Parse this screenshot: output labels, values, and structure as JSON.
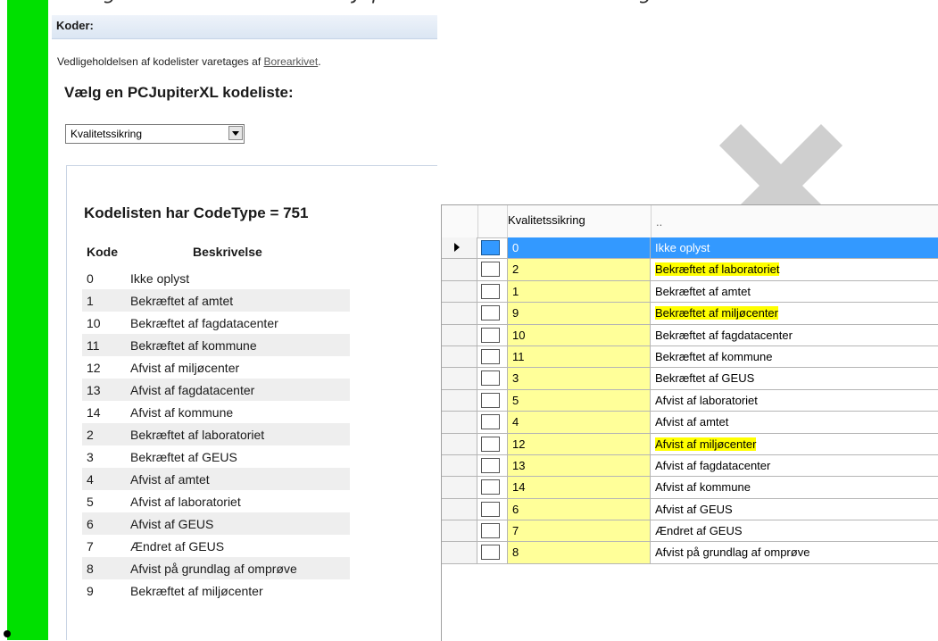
{
  "page": {
    "top_text": "erter følger de for MST relevante Jupiter-kodelister i forhold til grundvandskemi"
  },
  "web": {
    "header": "Koder:",
    "intro_prefix": "Vedligeholdelsen af kodelister varetages af ",
    "intro_link": "Borearkivet",
    "intro_suffix": ".",
    "heading": "Vælg en PCJupiterXL kodeliste:",
    "select_value": "Kvalitetssikring",
    "code_heading": "Kodelisten har CodeType = 751",
    "col_kode": "Kode",
    "col_beskrivelse": "Beskrivelse",
    "rows": [
      {
        "kode": "0",
        "beskrivelse": "Ikke oplyst"
      },
      {
        "kode": "1",
        "beskrivelse": "Bekræftet af amtet"
      },
      {
        "kode": "10",
        "beskrivelse": "Bekræftet af fagdatacenter"
      },
      {
        "kode": "11",
        "beskrivelse": "Bekræftet af kommune"
      },
      {
        "kode": "12",
        "beskrivelse": "Afvist af miljøcenter"
      },
      {
        "kode": "13",
        "beskrivelse": "Afvist af fagdatacenter"
      },
      {
        "kode": "14",
        "beskrivelse": "Afvist af kommune"
      },
      {
        "kode": "2",
        "beskrivelse": "Bekræftet af laboratoriet"
      },
      {
        "kode": "3",
        "beskrivelse": "Bekræftet af GEUS"
      },
      {
        "kode": "4",
        "beskrivelse": "Afvist af amtet"
      },
      {
        "kode": "5",
        "beskrivelse": "Afvist af laboratoriet"
      },
      {
        "kode": "6",
        "beskrivelse": "Afvist af GEUS"
      },
      {
        "kode": "7",
        "beskrivelse": "Ændret af GEUS"
      },
      {
        "kode": "8",
        "beskrivelse": "Afvist på grundlag af omprøve"
      },
      {
        "kode": "9",
        "beskrivelse": "Bekræftet af miljøcenter"
      }
    ]
  },
  "grid": {
    "col1": "Kvalitetssikring",
    "col2": "..",
    "highlight_color": "#ffff00",
    "selected_color": "#3399ff",
    "rows": [
      {
        "code": "0",
        "text": "Ikke oplyst",
        "selected": true
      },
      {
        "code": "2",
        "text": "Bekræftet af laboratoriet",
        "highlighted": true
      },
      {
        "code": "1",
        "text": "Bekræftet af amtet"
      },
      {
        "code": "9",
        "text": "Bekræftet af miljøcenter",
        "highlighted": true
      },
      {
        "code": "10",
        "text": "Bekræftet af fagdatacenter"
      },
      {
        "code": "11",
        "text": "Bekræftet af kommune"
      },
      {
        "code": "3",
        "text": "Bekræftet af GEUS"
      },
      {
        "code": "5",
        "text": "Afvist af laboratoriet"
      },
      {
        "code": "4",
        "text": "Afvist af amtet"
      },
      {
        "code": "12",
        "text": "Afvist af miljøcenter",
        "highlighted": true
      },
      {
        "code": "13",
        "text": "Afvist af fagdatacenter"
      },
      {
        "code": "14",
        "text": "Afvist af kommune"
      },
      {
        "code": "6",
        "text": "Afvist af GEUS"
      },
      {
        "code": "7",
        "text": "Ændret af GEUS"
      },
      {
        "code": "8",
        "text": "Afvist på grundlag af omprøve"
      }
    ]
  }
}
